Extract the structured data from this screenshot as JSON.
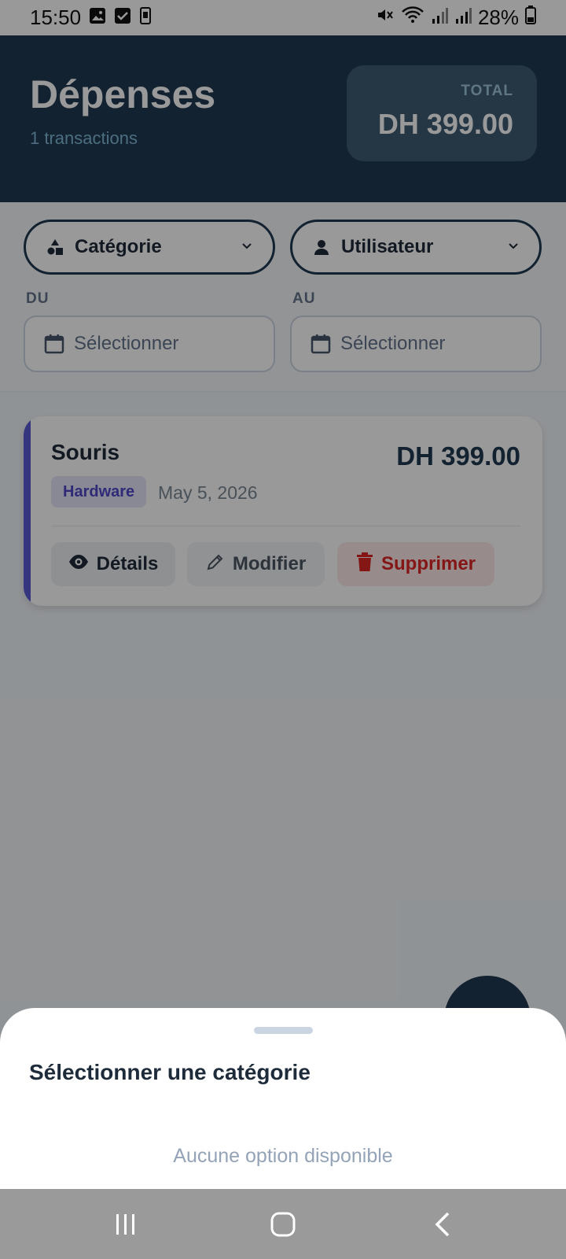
{
  "status_bar": {
    "time": "15:50",
    "battery": "28%",
    "left_icons": [
      "image-icon",
      "checkbox-icon",
      "phone-sim-icon"
    ],
    "right_icons": [
      "mute-icon",
      "wifi-icon",
      "signal-icon",
      "signal-icon",
      "battery-icon"
    ]
  },
  "header": {
    "title": "Dépenses",
    "subtitle": "1 transactions",
    "total_label": "TOTAL",
    "total_value": "DH 399.00"
  },
  "filters": {
    "category_label": "Catégorie",
    "user_label": "Utilisateur",
    "from_label": "DU",
    "to_label": "AU",
    "from_placeholder": "Sélectionner",
    "to_placeholder": "Sélectionner"
  },
  "expenses": [
    {
      "name": "Souris",
      "amount": "DH 399.00",
      "category": "Hardware",
      "date": "May 5, 2026",
      "actions": {
        "details": "Détails",
        "modify": "Modifier",
        "delete": "Supprimer"
      }
    }
  ],
  "sheet": {
    "title": "Sélectionner une catégorie",
    "empty": "Aucune option disponible"
  },
  "colors": {
    "header_bg": "#1e3a52",
    "accent": "#5b5bd6",
    "danger": "#dc2626"
  }
}
